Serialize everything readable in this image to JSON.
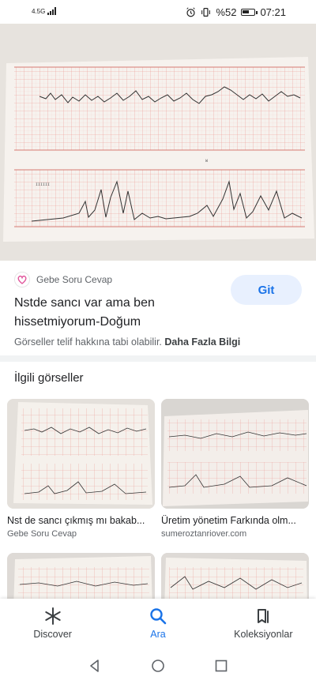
{
  "status_bar": {
    "network": "4.5G",
    "battery_percent": "%52",
    "time": "07:21",
    "icons": [
      "alarm-icon",
      "vibrate-icon",
      "battery-icon"
    ]
  },
  "result": {
    "source_name": "Gebe Soru Cevap",
    "title": "Nstde sancı var ama ben hissetmiyorum-Doğum",
    "visit_button": "Git",
    "copyright_text": "Görseller telif hakkına tabi olabilir.",
    "more_info_link": "Daha Fazla Bilgi"
  },
  "related": {
    "heading": "İlgili görseller",
    "items": [
      {
        "title": "Nst de sancı çıkmış mı bakab...",
        "source": "Gebe Soru Cevap"
      },
      {
        "title": "Üretim yönetim Farkında olm...",
        "source": "sumeroztanriover.com"
      }
    ]
  },
  "bottom_nav": {
    "items": [
      {
        "label": "Discover",
        "icon": "asterisk-icon"
      },
      {
        "label": "Ara",
        "icon": "search-icon"
      },
      {
        "label": "Koleksiyonlar",
        "icon": "collections-icon"
      }
    ],
    "active_index": 1
  },
  "colors": {
    "accent": "#1a73e8",
    "button_bg": "#e8f0fe",
    "chart_grid": "#e8a09a",
    "paper": "#f5f1ec"
  }
}
